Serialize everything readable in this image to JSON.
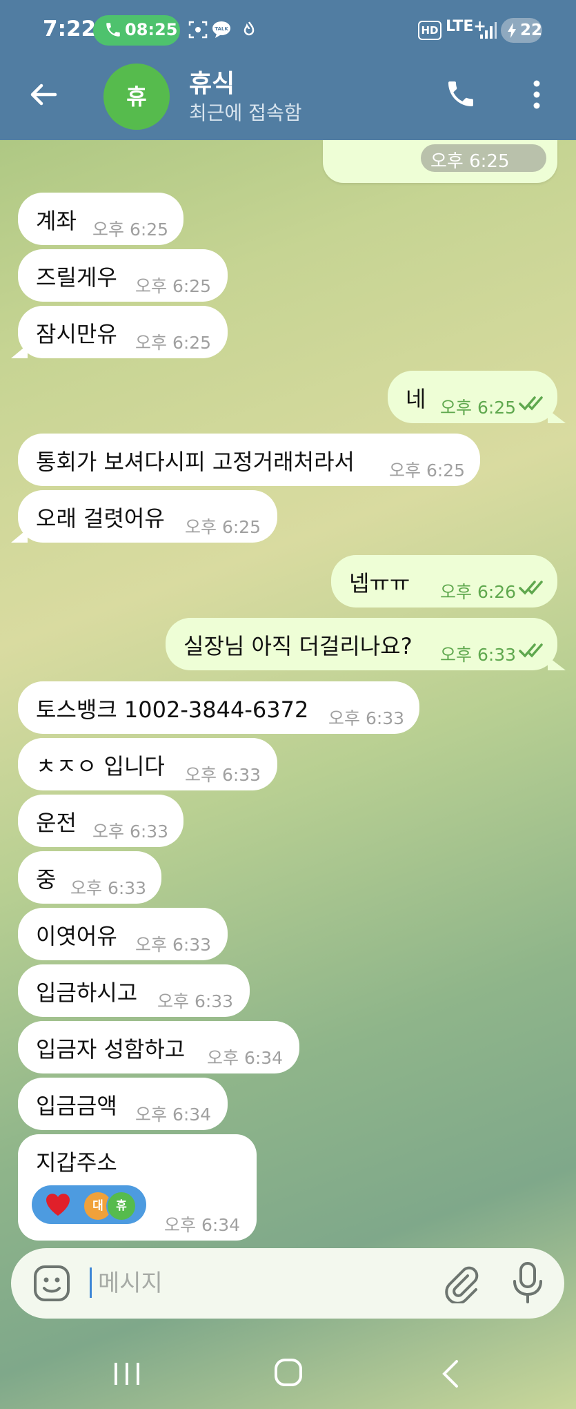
{
  "status_bar": {
    "time": "7:22",
    "call_time": "08:25",
    "hd": "HD",
    "network": "LTE+",
    "battery": "22"
  },
  "header": {
    "avatar_letter": "휴",
    "name": "휴식",
    "presence": "최근에 접속함"
  },
  "top_partial_time": "오후 6:25",
  "messages": [
    {
      "dir": "in",
      "text": "계좌",
      "time": "오후 6:25"
    },
    {
      "dir": "in",
      "text": "즈릴게우",
      "time": "오후 6:25"
    },
    {
      "dir": "in",
      "text": "잠시만유",
      "time": "오후 6:25"
    },
    {
      "dir": "out",
      "text": "네",
      "time": "오후 6:25"
    },
    {
      "dir": "in",
      "text": "통회가 보셔다시피 고정거래처라서",
      "time": "오후 6:25"
    },
    {
      "dir": "in",
      "text": "오래 걸렷어유",
      "time": "오후 6:25"
    },
    {
      "dir": "out",
      "text": "넵ㅠㅠ",
      "time": "오후 6:26"
    },
    {
      "dir": "out",
      "text": "실장님 아직 더걸리나요?",
      "time": "오후 6:33"
    },
    {
      "dir": "in",
      "text": "토스뱅크 1002-3844-6372",
      "time": "오후 6:33"
    },
    {
      "dir": "in",
      "text": "ㅊㅈㅇ 입니다",
      "time": "오후 6:33"
    },
    {
      "dir": "in",
      "text": "운전",
      "time": "오후 6:33"
    },
    {
      "dir": "in",
      "text": "중",
      "time": "오후 6:33"
    },
    {
      "dir": "in",
      "text": "이엿어유",
      "time": "오후 6:33"
    },
    {
      "dir": "in",
      "text": "입금하시고",
      "time": "오후 6:33"
    },
    {
      "dir": "in",
      "text": "입금자 성함하고",
      "time": "오후 6:34"
    },
    {
      "dir": "in",
      "text": "입금금액",
      "time": "오후 6:34"
    },
    {
      "dir": "in",
      "text": "지갑주소",
      "time": "오후 6:34"
    }
  ],
  "reaction": {
    "emoji_icon": "heart-icon",
    "avatar1": "대",
    "avatar2": "휴"
  },
  "composer": {
    "placeholder": "메시지"
  }
}
